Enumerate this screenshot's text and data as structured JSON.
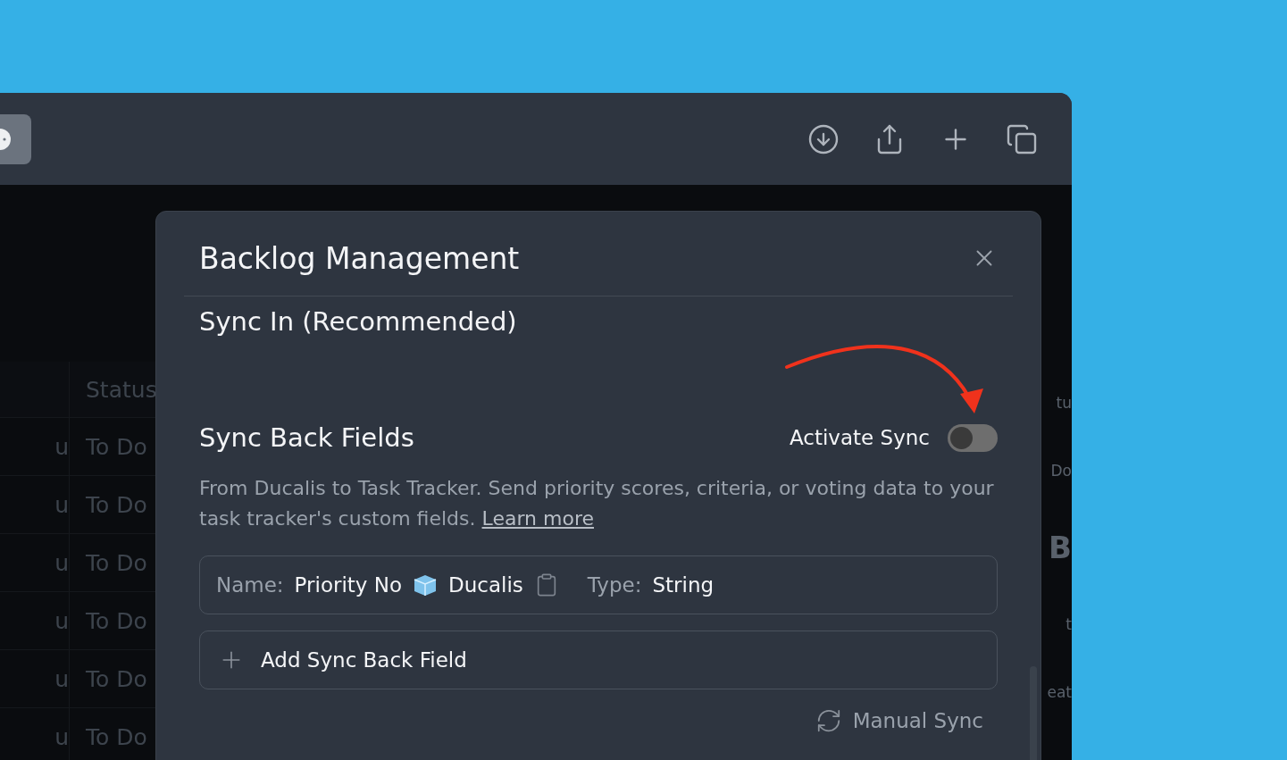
{
  "background_table": {
    "header": "Status",
    "rows": [
      {
        "column_1": "u",
        "status": "To Do"
      },
      {
        "column_1": "u",
        "status": "To Do"
      },
      {
        "column_1": "u",
        "status": "To Do"
      },
      {
        "column_1": "u",
        "status": "To Do"
      },
      {
        "column_1": "u",
        "status": "To Do"
      },
      {
        "column_1": "u",
        "status": "To Do"
      }
    ],
    "right_fragments": [
      "tu",
      "Do",
      "B",
      "t",
      "eat"
    ]
  },
  "dialog": {
    "title": "Backlog Management",
    "sync_in": {
      "heading": "Sync In (Recommended)"
    },
    "sync_back": {
      "heading": "Sync Back Fields",
      "activate_label": "Activate Sync",
      "activate_on": false,
      "description": "From Ducalis to Task Tracker. Send priority scores, criteria, or voting data to your task tracker's custom fields.",
      "link": "Learn more",
      "fields": [
        {
          "name_label": "Name:",
          "name": "Priority No",
          "source": "Ducalis",
          "type_label": "Type:",
          "type": "String"
        }
      ],
      "add_button": "Add Sync Back Field",
      "manual_sync": "Manual Sync"
    }
  }
}
